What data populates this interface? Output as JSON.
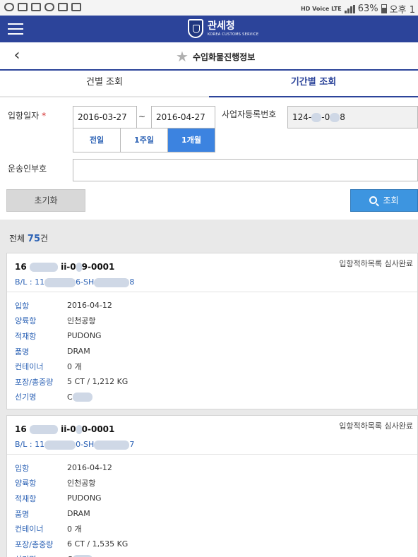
{
  "status_bar": {
    "network": "HD Voice LTE",
    "battery": "63%",
    "time": "오후 1"
  },
  "header": {
    "logo_ko": "관세청",
    "logo_en": "KOREA CUSTOMS SERVICE"
  },
  "subheader": {
    "title": "수입화물진행정보"
  },
  "tabs": [
    {
      "label": "건별 조회",
      "active": false
    },
    {
      "label": "기간별 조회",
      "active": true
    }
  ],
  "form": {
    "arrival_date_label": "입항일자",
    "required_mark": "*",
    "date_from": "2016-03-27",
    "date_to": "2016-04-27",
    "tilde": "~",
    "biz_reg_label": "사업자등록번호",
    "biz_reg_parts": [
      "124-",
      "-0",
      "8"
    ],
    "period_buttons": [
      {
        "label": "전일",
        "active": false
      },
      {
        "label": "1주일",
        "active": false
      },
      {
        "label": "1개월",
        "active": true
      }
    ],
    "carrier_label": "운송인부호",
    "carrier_value": "",
    "reset_label": "초기화",
    "search_label": "조회"
  },
  "result": {
    "total_prefix": "전체 ",
    "total_count": "75",
    "total_suffix": "건"
  },
  "cards": [
    {
      "no_parts": [
        "16",
        "ii-0",
        "9-0001"
      ],
      "status": "입항적하목록 심사완료",
      "bl_parts": [
        "B/L : 11",
        "6-SH",
        "8"
      ],
      "fields": [
        {
          "key": "입항",
          "value": "2016-04-12"
        },
        {
          "key": "양륙항",
          "value": "인천공항"
        },
        {
          "key": "적재항",
          "value": "PUDONG"
        },
        {
          "key": "품명",
          "value": "DRAM"
        },
        {
          "key": "컨테이너",
          "value": "0 개"
        },
        {
          "key": "포장/총중량",
          "value": "5 CT / 1,212 KG"
        },
        {
          "key": "선기명",
          "value": "C"
        }
      ]
    },
    {
      "no_parts": [
        "16",
        "ii-0",
        "0-0001"
      ],
      "status": "입항적하목록 심사완료",
      "bl_parts": [
        "B/L : 11",
        "0-SH",
        "7"
      ],
      "fields": [
        {
          "key": "입항",
          "value": "2016-04-12"
        },
        {
          "key": "양륙항",
          "value": "인천공항"
        },
        {
          "key": "적재항",
          "value": "PUDONG"
        },
        {
          "key": "품명",
          "value": "DRAM"
        },
        {
          "key": "컨테이너",
          "value": "0 개"
        },
        {
          "key": "포장/총중량",
          "value": "6 CT / 1,535 KG"
        },
        {
          "key": "선기명",
          "value": "C"
        }
      ]
    }
  ]
}
